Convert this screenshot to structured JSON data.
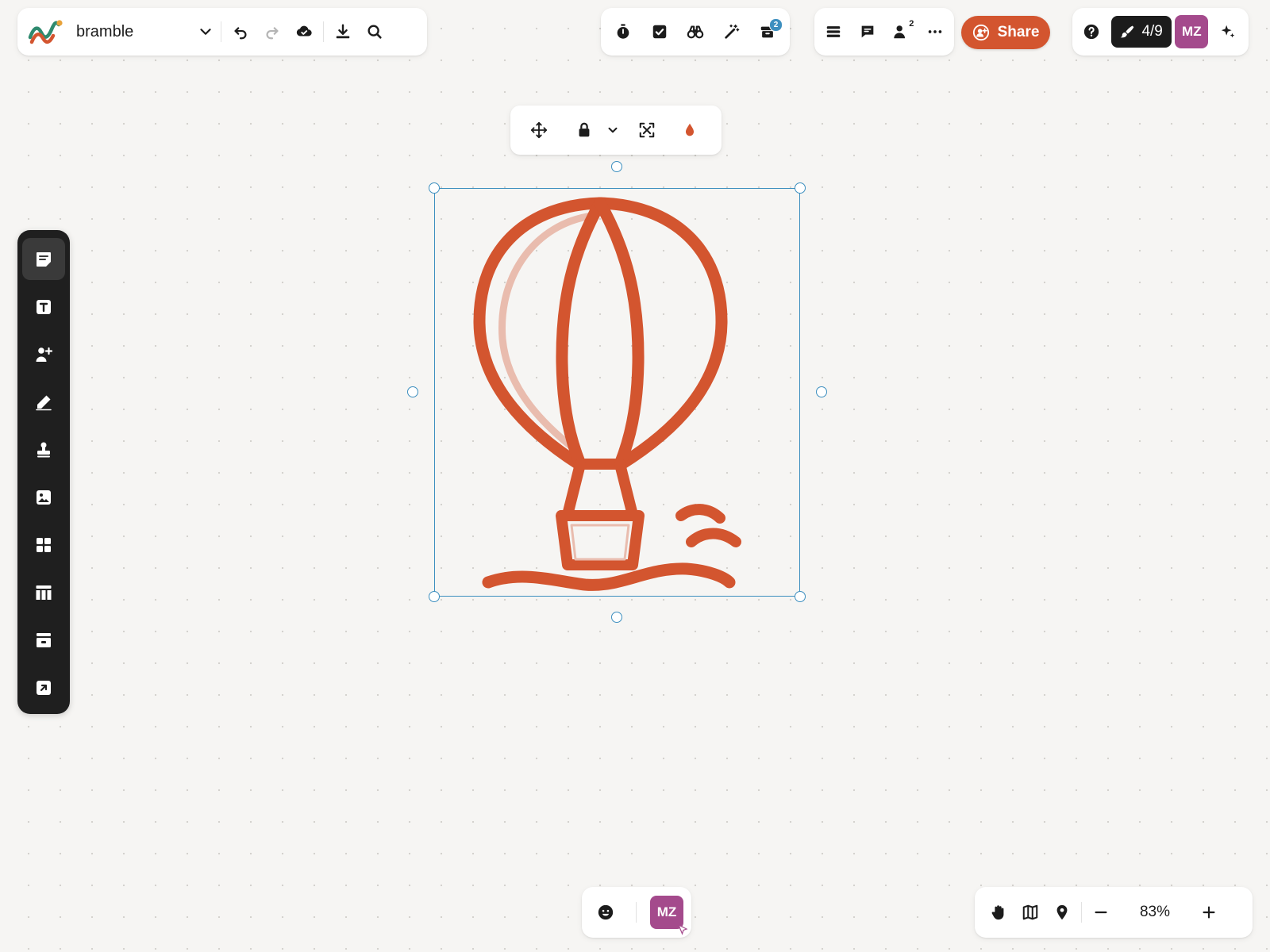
{
  "board": {
    "name": "bramble",
    "brand_colors": [
      "#2e8a6e",
      "#d3552f",
      "#e8a23a"
    ]
  },
  "toolbar_top": {
    "tools": [
      "timer-icon",
      "task-check-icon",
      "binoculars-icon",
      "magic-wand-icon",
      "archive-box-icon"
    ],
    "archive_badge": "2"
  },
  "collab": {
    "collaborators_count": "2",
    "share_label": "Share",
    "share_color": "#d3552f"
  },
  "account": {
    "progress": "4/9",
    "avatar_initials": "MZ",
    "avatar_color": "#a44a8c"
  },
  "left_toolbar": {
    "items": [
      "sticky-note",
      "text",
      "person-add",
      "pen",
      "stamp",
      "image",
      "templates",
      "table",
      "frame",
      "embed"
    ],
    "active": "sticky-note"
  },
  "canvas": {
    "selection_color": "#3d8fbf",
    "drawing_color": "#d3552f",
    "drawing_highlight": "#e9bcae"
  },
  "bottom": {
    "avatar_initials": "MZ",
    "zoom_level": "83%"
  }
}
